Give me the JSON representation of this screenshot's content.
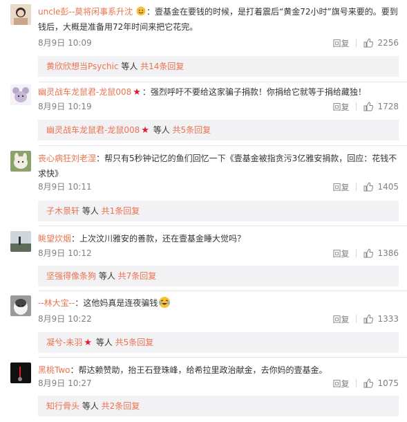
{
  "colors": {
    "link": "#eb7350",
    "meta": "#808080",
    "text": "#333333",
    "subbox": "#f2f2f5"
  },
  "comments": [
    {
      "username": "uncle彭--莫将闲事系升沈",
      "badge": "emoji-face-icon",
      "text": "：壹基金在要钱的时候，是打着震后“黄金72小时”旗号来要的。要到钱后，大概是准备用72年时间来把它花完。",
      "date": "8月9日 10:09",
      "reply_label": "回复",
      "likes": "2256",
      "sub_user": "黄欣欣想当Psychic",
      "sub_mid": " 等人 ",
      "sub_count": "共14条回复"
    },
    {
      "username": "幽灵战车龙鼠君-龙鼠008",
      "badge": "star-icon",
      "text": "：强烈呼吁不要给这家骗子捐款！你捐给它就等于捐给藏独！",
      "date": "8月9日 10:19",
      "reply_label": "回复",
      "likes": "1728",
      "sub_user": "幽灵战车龙鼠君-龙鼠008",
      "sub_mid": " 等人 ",
      "sub_count": "共5条回复"
    },
    {
      "username": "丧心病狂刘老湿",
      "text": "：帮只有5秒钟记忆的鱼们回忆一下《壹基金被指贪污3亿雅安捐款，回应：花钱不求快》",
      "date": "8月9日 10:11",
      "reply_label": "回复",
      "likes": "1405",
      "sub_user": "子木景轩",
      "sub_mid": " 等人 ",
      "sub_count": "共1条回复"
    },
    {
      "username": "眺望炊烟",
      "text": "：上次汶川雅安的善款，还在壹基金睡大觉吗？",
      "date": "8月9日 10:12",
      "reply_label": "回复",
      "likes": "1386",
      "sub_user": "坚强得像条狗",
      "sub_mid": " 等人 ",
      "sub_count": "共7条回复"
    },
    {
      "username": "--林大宝--",
      "text": "：这他妈真是连夜骗钱",
      "emoji": "crying-laugh-emoji-icon",
      "date": "8月9日 10:22",
      "reply_label": "回复",
      "likes": "1333",
      "sub_user": "凝兮-未羽",
      "badge_sub": "star-icon",
      "sub_mid": " 等人 ",
      "sub_count": "共5条回复"
    },
    {
      "username": "黑桃Two",
      "text": "：帮达赖赞助，抬王石登珠峰，给希拉里政治献金，去你妈的壹基金。",
      "date": "8月9日 10:27",
      "reply_label": "回复",
      "likes": "1075",
      "sub_user": "知行骨头",
      "sub_mid": " 等人 ",
      "sub_count": "共2条回复"
    }
  ]
}
